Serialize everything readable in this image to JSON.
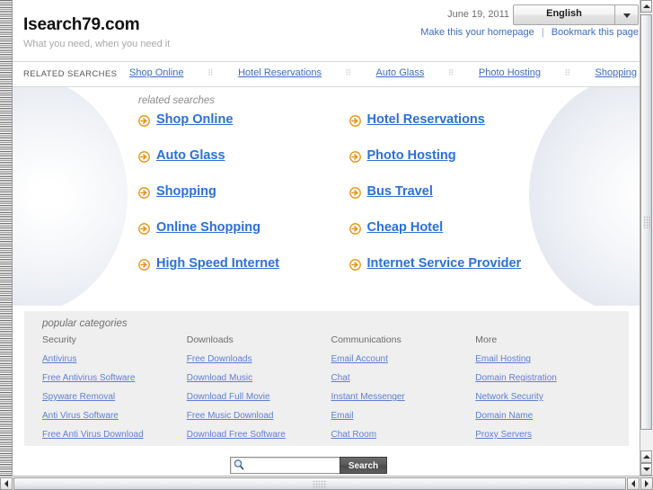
{
  "header": {
    "logo": "Isearch79.com",
    "tagline": "What you need, when you need it",
    "date": "June 19, 2011",
    "language": "English",
    "make_homepage": "Make this your homepage",
    "bookmark": "Bookmark this page"
  },
  "related_strip": {
    "label": "RELATED SEARCHES",
    "items": [
      "Shop Online",
      "Hotel Reservations",
      "Auto Glass",
      "Photo Hosting",
      "Shopping"
    ]
  },
  "main": {
    "title": "related searches",
    "rows": [
      {
        "left": "Shop Online",
        "right": "Hotel Reservations"
      },
      {
        "left": "Auto Glass",
        "right": "Photo Hosting"
      },
      {
        "left": "Shopping",
        "right": "Bus Travel"
      },
      {
        "left": "Online Shopping",
        "right": "Cheap Hotel"
      },
      {
        "left": "High Speed Internet",
        "right": "Internet Service Provider"
      }
    ]
  },
  "categories": {
    "title": "popular categories",
    "columns": [
      {
        "heading": "Security",
        "links": [
          "Antivirus",
          "Free Antivirus Software",
          "Spyware Removal",
          "Anti Virus Software",
          "Free Anti Virus Download"
        ]
      },
      {
        "heading": "Downloads",
        "links": [
          "Free Downloads",
          "Download Music",
          "Download Full Movie",
          "Free Music Download",
          "Download Free Software"
        ]
      },
      {
        "heading": "Communications",
        "links": [
          "Email Account",
          "Chat",
          "Instant Messenger",
          "Email",
          "Chat Room"
        ]
      },
      {
        "heading": "More",
        "links": [
          "Email Hosting",
          "Domain Registration",
          "Network Security",
          "Domain Name",
          "Proxy Servers"
        ]
      }
    ]
  },
  "search": {
    "value": "",
    "placeholder": "",
    "button_label": "Search"
  },
  "colors": {
    "link_blue": "#2a6fdb",
    "nav_blue": "#3b6bc4",
    "cat_link_blue": "#5b7fd4",
    "arrow_orange": "#e8920b",
    "panel_gray": "#efefef"
  }
}
